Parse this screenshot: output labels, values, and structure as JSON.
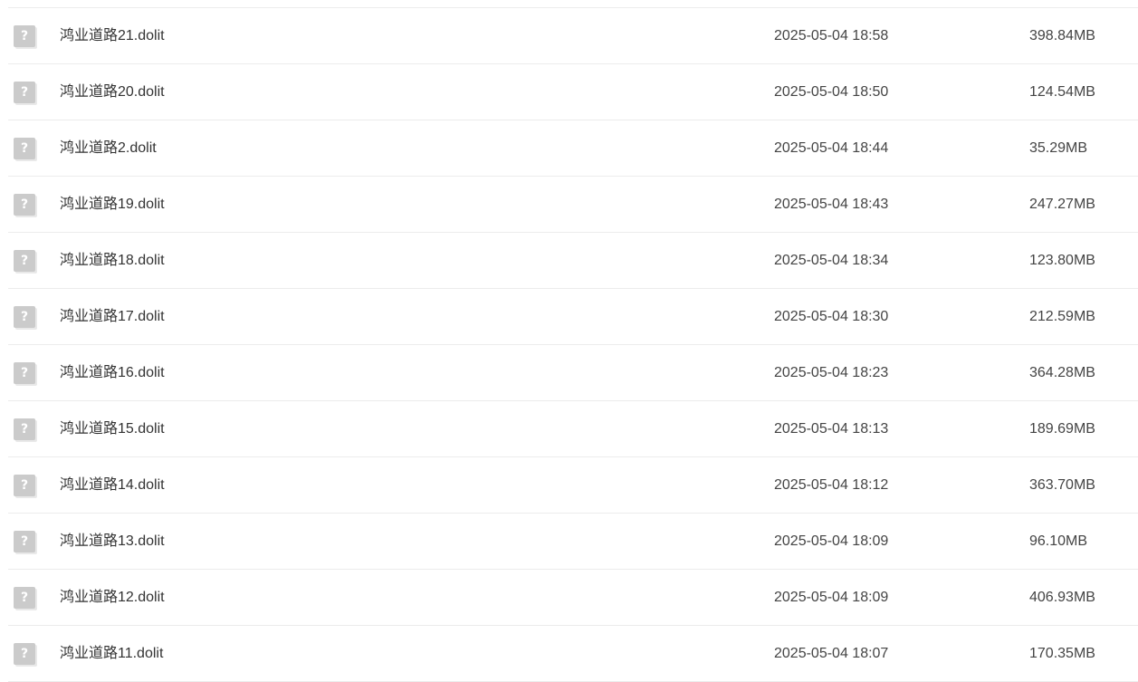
{
  "icon": {
    "name": "unknown-file-icon",
    "glyph": "?",
    "color": "#cbcbcb"
  },
  "files": [
    {
      "name": "鸿业道路21.dolit",
      "modified": "2025-05-04 18:58",
      "size": "398.84MB"
    },
    {
      "name": "鸿业道路20.dolit",
      "modified": "2025-05-04 18:50",
      "size": "124.54MB"
    },
    {
      "name": "鸿业道路2.dolit",
      "modified": "2025-05-04 18:44",
      "size": "35.29MB"
    },
    {
      "name": "鸿业道路19.dolit",
      "modified": "2025-05-04 18:43",
      "size": "247.27MB"
    },
    {
      "name": "鸿业道路18.dolit",
      "modified": "2025-05-04 18:34",
      "size": "123.80MB"
    },
    {
      "name": "鸿业道路17.dolit",
      "modified": "2025-05-04 18:30",
      "size": "212.59MB"
    },
    {
      "name": "鸿业道路16.dolit",
      "modified": "2025-05-04 18:23",
      "size": "364.28MB"
    },
    {
      "name": "鸿业道路15.dolit",
      "modified": "2025-05-04 18:13",
      "size": "189.69MB"
    },
    {
      "name": "鸿业道路14.dolit",
      "modified": "2025-05-04 18:12",
      "size": "363.70MB"
    },
    {
      "name": "鸿业道路13.dolit",
      "modified": "2025-05-04 18:09",
      "size": "96.10MB"
    },
    {
      "name": "鸿业道路12.dolit",
      "modified": "2025-05-04 18:09",
      "size": "406.93MB"
    },
    {
      "name": "鸿业道路11.dolit",
      "modified": "2025-05-04 18:07",
      "size": "170.35MB"
    }
  ]
}
